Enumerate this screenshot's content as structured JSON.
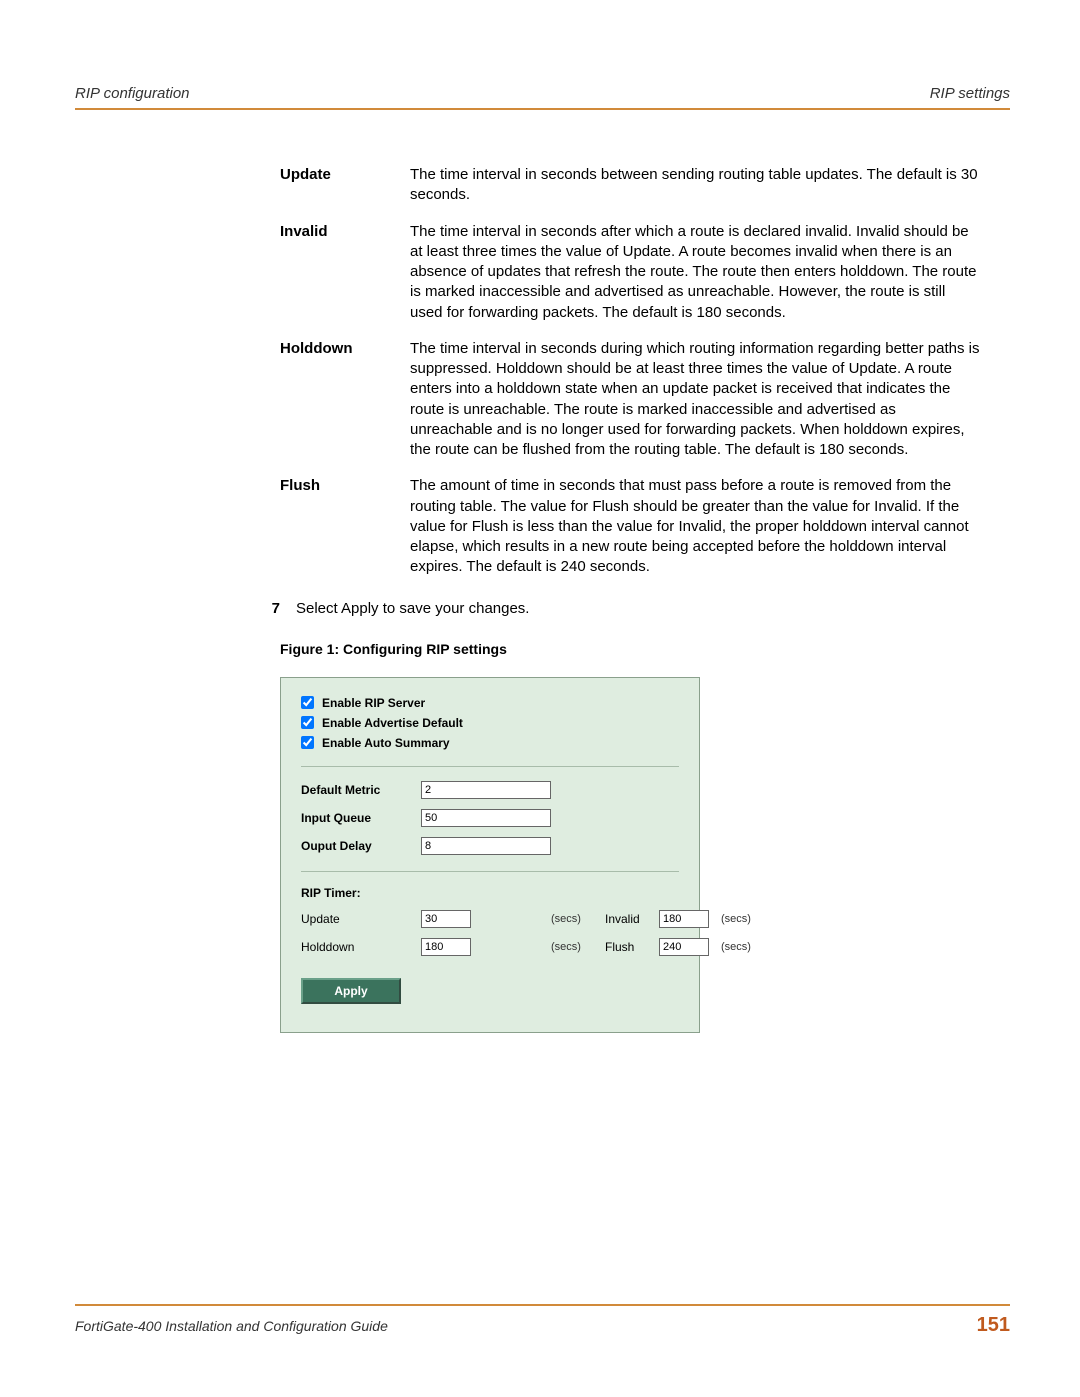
{
  "header": {
    "left": "RIP configuration",
    "right": "RIP settings"
  },
  "definitions": [
    {
      "term": "Update",
      "desc": "The time interval in seconds between sending routing table updates. The default is 30 seconds."
    },
    {
      "term": "Invalid",
      "desc": "The time interval in seconds after which a route is declared invalid. Invalid should be at least three times the value of Update. A route becomes invalid when there is an absence of updates that refresh the route. The route then enters holddown. The route is marked inaccessible and advertised as unreachable. However, the route is still used for forwarding packets. The default is 180 seconds."
    },
    {
      "term": "Holddown",
      "desc": "The time interval in seconds during which routing information regarding better paths is suppressed. Holddown should be at least three times the value of Update. A route enters into a holddown state when an update packet is received that indicates the route is unreachable. The route is marked inaccessible and advertised as unreachable and is no longer used for forwarding packets. When holddown expires, the route can be flushed from the routing table. The default is 180 seconds."
    },
    {
      "term": "Flush",
      "desc": "The amount of time in seconds that must pass before a route is removed from the routing table. The value for Flush should be greater than the value for Invalid. If the value for Flush is less than the value for Invalid, the proper holddown interval cannot elapse, which results in a new route being accepted before the holddown interval expires. The default is 240 seconds."
    }
  ],
  "step": {
    "num": "7",
    "text": "Select Apply to save your changes."
  },
  "figure_caption": "Figure 1:  Configuring RIP settings",
  "panel": {
    "checkboxes": [
      {
        "label": "Enable RIP Server",
        "checked": true
      },
      {
        "label": "Enable Advertise Default",
        "checked": true
      },
      {
        "label": "Enable Auto Summary",
        "checked": true
      }
    ],
    "fields": {
      "default_metric": {
        "label": "Default Metric",
        "value": "2"
      },
      "input_queue": {
        "label": "Input Queue",
        "value": "50"
      },
      "output_delay": {
        "label": "Ouput Delay",
        "value": "8"
      }
    },
    "timer_title": "RIP Timer:",
    "timers": {
      "update": {
        "label": "Update",
        "value": "30"
      },
      "invalid": {
        "label": "Invalid",
        "value": "180"
      },
      "holddown": {
        "label": "Holddown",
        "value": "180"
      },
      "flush": {
        "label": "Flush",
        "value": "240"
      }
    },
    "secs_label": "(secs)",
    "apply_label": "Apply"
  },
  "footer": {
    "title": "FortiGate-400 Installation and Configuration Guide",
    "page": "151"
  }
}
